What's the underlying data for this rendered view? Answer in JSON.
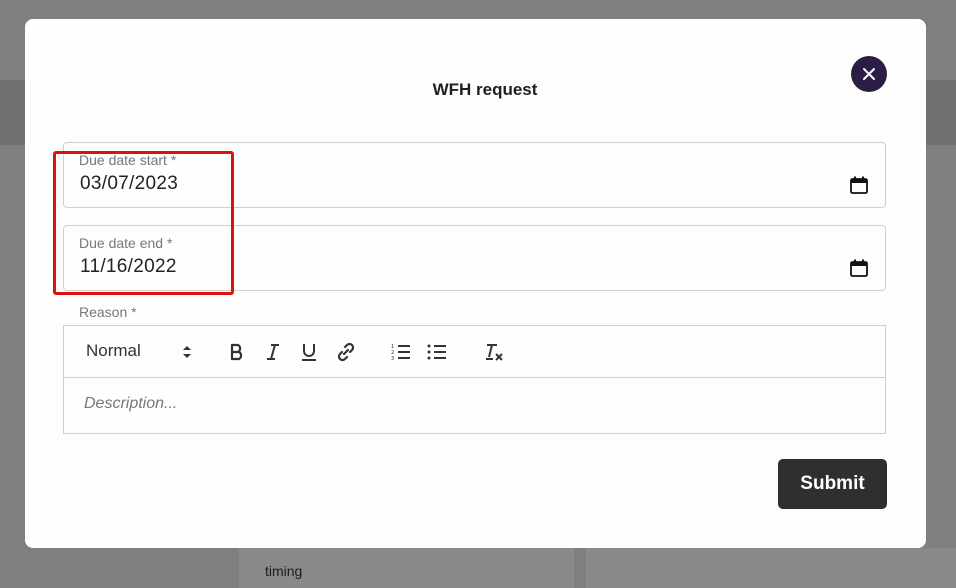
{
  "background": {
    "hint_text": "timing"
  },
  "modal": {
    "title": "WFH request",
    "close_icon": "close-icon",
    "fields": {
      "start": {
        "label": "Due date start *",
        "value": "03/07/2023",
        "icon": "calendar-icon"
      },
      "end": {
        "label": "Due date end *",
        "value": "11/16/2022",
        "icon": "calendar-icon"
      }
    },
    "reason": {
      "label": "Reason *",
      "toolbar": {
        "format_select": "Normal",
        "buttons": [
          "bold-icon",
          "italic-icon",
          "underline-icon",
          "link-icon",
          "ordered-list-icon",
          "bullet-list-icon",
          "clear-format-icon"
        ]
      },
      "placeholder": "Description..."
    },
    "submit_label": "Submit"
  },
  "colors": {
    "close_button": "#2b1d45",
    "submit_button": "#2f2f2f",
    "highlight": "#e01010",
    "overlay": "#7f7f7f"
  }
}
